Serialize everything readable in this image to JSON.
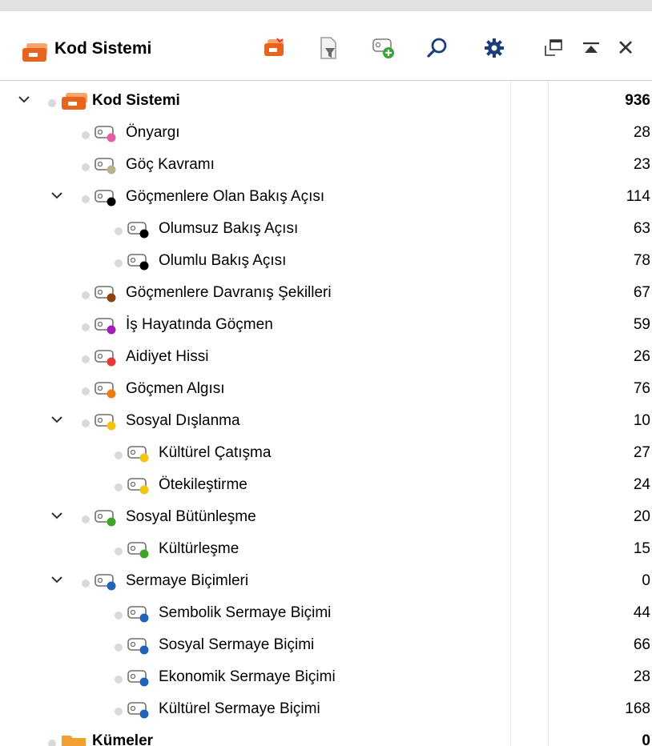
{
  "header": {
    "title": "Kod Sistemi",
    "accent": "#e8641e"
  },
  "toolbar": {
    "icons": [
      "new-code-system-icon",
      "filter-icon",
      "add-code-icon",
      "search-icon",
      "settings-icon",
      "undock-icon",
      "collapse-icon",
      "close-icon"
    ]
  },
  "rows": [
    {
      "label": "Kod Sistemi",
      "count": "936",
      "bold": true,
      "color": "#e8641e",
      "type": "root"
    },
    {
      "label": "Önyargı",
      "count": "28",
      "color": "#e060a8"
    },
    {
      "label": "Göç Kavramı",
      "count": "23",
      "color": "#b8b48a"
    },
    {
      "label": "Göçmenlere Olan Bakış Açısı",
      "count": "114",
      "color": "#000000"
    },
    {
      "label": "Olumsuz Bakış Açısı",
      "count": "63",
      "color": "#000000"
    },
    {
      "label": "Olumlu Bakış Açısı",
      "count": "78",
      "color": "#000000"
    },
    {
      "label": "Göçmenlere Davranış Şekilleri",
      "count": "67",
      "color": "#8b4513"
    },
    {
      "label": "İş Hayatında Göçmen",
      "count": "59",
      "color": "#a020b8"
    },
    {
      "label": "Aidiyet Hissi",
      "count": "26",
      "color": "#e53935"
    },
    {
      "label": "Göçmen Algısı",
      "count": "76",
      "color": "#ee7b18"
    },
    {
      "label": "Sosyal Dışlanma",
      "count": "10",
      "color": "#f2c40f"
    },
    {
      "label": "Kültürel Çatışma",
      "count": "27",
      "color": "#f2c40f"
    },
    {
      "label": "Ötekileştirme",
      "count": "24",
      "color": "#f2c40f"
    },
    {
      "label": "Sosyal Bütünleşme",
      "count": "20",
      "color": "#43a42b"
    },
    {
      "label": "Kültürleşme",
      "count": "15",
      "color": "#43a42b"
    },
    {
      "label": "Sermaye Biçimleri",
      "count": "0",
      "color": "#2464b4"
    },
    {
      "label": "Sembolik Sermaye Biçimi",
      "count": "44",
      "color": "#2464b4"
    },
    {
      "label": "Sosyal Sermaye Biçimi",
      "count": "66",
      "color": "#2464b4"
    },
    {
      "label": "Ekonomik Sermaye Biçimi",
      "count": "28",
      "color": "#2464b4"
    },
    {
      "label": "Kültürel Sermaye Biçimi",
      "count": "168",
      "color": "#2464b4"
    },
    {
      "label": "Kümeler",
      "count": "0",
      "bold": true,
      "color": "#f0a030",
      "type": "folder"
    }
  ]
}
